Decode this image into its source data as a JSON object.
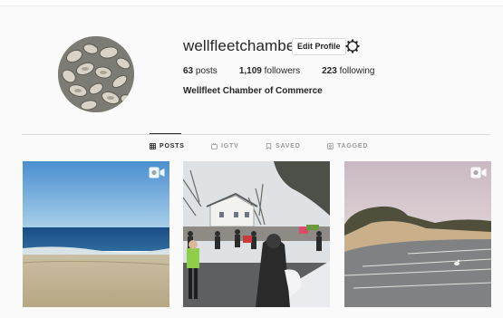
{
  "profile": {
    "username": "wellfleetchamber",
    "edit_label": "Edit Profile",
    "posts_count": "63",
    "posts_label": "posts",
    "followers_count": "1,109",
    "followers_label": "followers",
    "following_count": "223",
    "following_label": "following",
    "full_name": "Wellfleet Chamber of Commerce"
  },
  "tabs": [
    {
      "label": "POSTS",
      "icon": "grid-icon",
      "active": true
    },
    {
      "label": "IGTV",
      "icon": "igtv-icon",
      "active": false
    },
    {
      "label": "SAVED",
      "icon": "bookmark-icon",
      "active": false
    },
    {
      "label": "TAGGED",
      "icon": "tag-icon",
      "active": false
    }
  ],
  "posts": [
    {
      "kind": "video",
      "icon": "video-camera-icon"
    },
    {
      "kind": "image"
    },
    {
      "kind": "video",
      "icon": "video-camera-icon"
    }
  ],
  "colors": {
    "background": "#fafafa",
    "text": "#262626",
    "muted": "#999999",
    "border": "#dbdbdb"
  }
}
